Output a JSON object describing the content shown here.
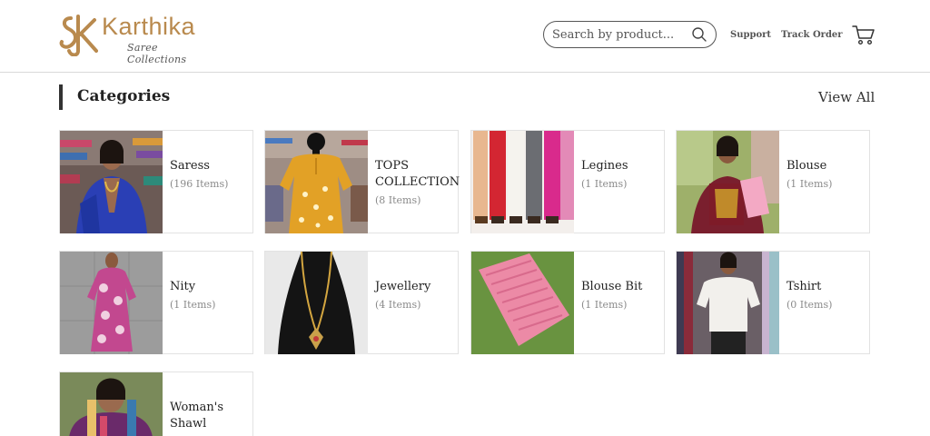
{
  "brand": {
    "name": "Karthika",
    "tagline": "Saree Collections",
    "colors": {
      "gold": "#b98a4e"
    }
  },
  "header": {
    "search_placeholder": "Search by product...",
    "support_label": "Support",
    "track_order_label": "Track Order"
  },
  "section": {
    "title": "Categories",
    "view_all_label": "View All"
  },
  "categories": [
    {
      "name": "Saress",
      "count": "(196 Items)",
      "icon": "photo"
    },
    {
      "name": "TOPS COLLECTION",
      "count": "(8 Items)",
      "icon": "photo"
    },
    {
      "name": "Legines",
      "count": "(1 Items)",
      "icon": "photo"
    },
    {
      "name": "Blouse",
      "count": "(1 Items)",
      "icon": "photo"
    },
    {
      "name": "Nity",
      "count": "(1 Items)",
      "icon": "photo"
    },
    {
      "name": "Jewellery",
      "count": "(4 Items)",
      "icon": "photo"
    },
    {
      "name": "Blouse Bit",
      "count": "(1 Items)",
      "icon": "photo"
    },
    {
      "name": "Tshirt",
      "count": "(0 Items)",
      "icon": "photo"
    },
    {
      "name": "Woman's Shawl",
      "count": "",
      "icon": "photo"
    }
  ]
}
